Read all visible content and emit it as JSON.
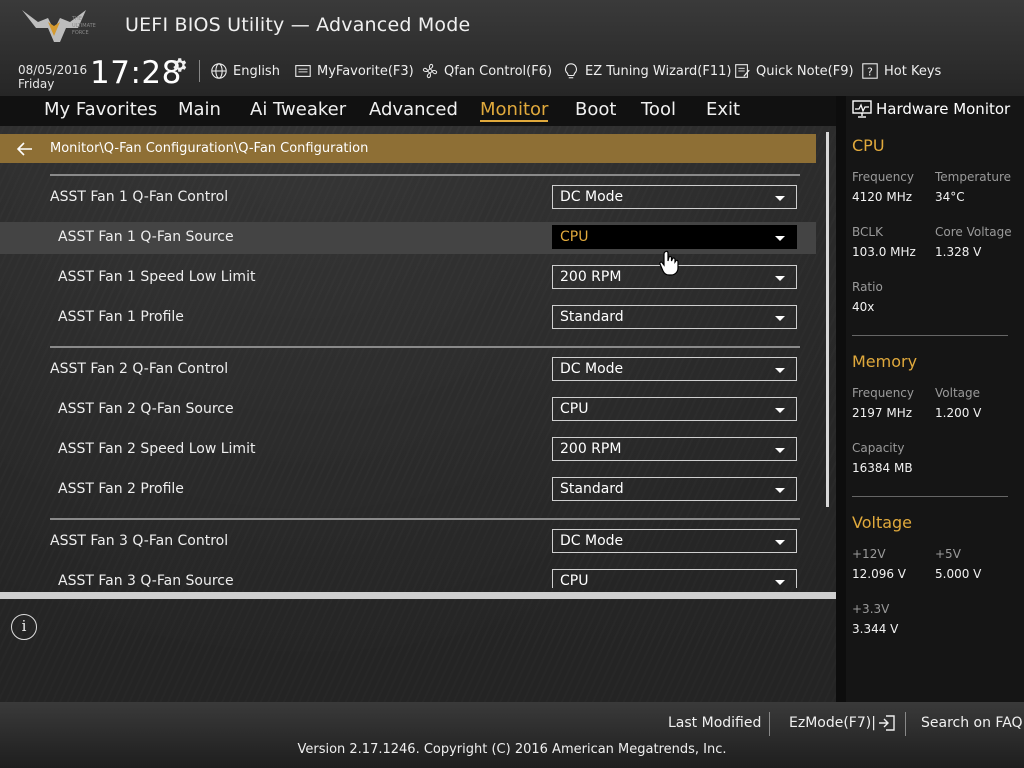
{
  "header": {
    "title": "UEFI BIOS Utility — Advanced Mode",
    "logo_text": [
      "THE",
      "ULTIMATE",
      "FORCE"
    ],
    "date": "08/05/2016",
    "day": "Friday",
    "time": "17:28",
    "toolbar": [
      {
        "label": "English",
        "icon": "globe-icon"
      },
      {
        "label": "MyFavorite(F3)",
        "icon": "favorite-list-icon"
      },
      {
        "label": "Qfan Control(F6)",
        "icon": "fan-icon"
      },
      {
        "label": "EZ Tuning Wizard(F11)",
        "icon": "lightbulb-icon"
      },
      {
        "label": "Quick Note(F9)",
        "icon": "note-icon"
      },
      {
        "label": "Hot Keys",
        "icon": "question-icon"
      }
    ]
  },
  "tabs": [
    "My Favorites",
    "Main",
    "Ai Tweaker",
    "Advanced",
    "Monitor",
    "Boot",
    "Tool",
    "Exit"
  ],
  "active_tab": "Monitor",
  "breadcrumb": "Monitor\\Q-Fan Configuration\\Q-Fan Configuration",
  "settings": [
    {
      "label": "ASST Fan 1 Q-Fan Control",
      "value": "DC Mode"
    },
    {
      "label": "ASST Fan 1 Q-Fan Source",
      "value": "CPU"
    },
    {
      "label": "ASST Fan 1 Speed Low Limit",
      "value": "200 RPM"
    },
    {
      "label": "ASST Fan 1 Profile",
      "value": "Standard"
    },
    {
      "label": "ASST Fan 2 Q-Fan Control",
      "value": "DC Mode"
    },
    {
      "label": "ASST Fan 2 Q-Fan Source",
      "value": "CPU"
    },
    {
      "label": "ASST Fan 2 Speed Low Limit",
      "value": "200 RPM"
    },
    {
      "label": "ASST Fan 2 Profile",
      "value": "Standard"
    },
    {
      "label": "ASST Fan 3 Q-Fan Control",
      "value": "DC Mode"
    },
    {
      "label": "ASST Fan 3 Q-Fan Source",
      "value": "CPU"
    }
  ],
  "hardware_monitor": {
    "title": "Hardware Monitor",
    "cpu": {
      "heading": "CPU",
      "frequency_label": "Frequency",
      "frequency": "4120 MHz",
      "temperature_label": "Temperature",
      "temperature": "34°C",
      "bclk_label": "BCLK",
      "bclk": "103.0 MHz",
      "core_voltage_label": "Core Voltage",
      "core_voltage": "1.328 V",
      "ratio_label": "Ratio",
      "ratio": "40x"
    },
    "memory": {
      "heading": "Memory",
      "frequency_label": "Frequency",
      "frequency": "2197 MHz",
      "voltage_label": "Voltage",
      "voltage": "1.200 V",
      "capacity_label": "Capacity",
      "capacity": "16384 MB"
    },
    "voltage": {
      "heading": "Voltage",
      "v12_label": "+12V",
      "v12": "12.096 V",
      "v5_label": "+5V",
      "v5": "5.000 V",
      "v33_label": "+3.3V",
      "v33": "3.344 V"
    }
  },
  "footer": {
    "last_modified": "Last Modified",
    "ezmode": "EzMode(F7)|",
    "search_faq": "Search on FAQ",
    "copyright": "Version 2.17.1246. Copyright (C) 2016 American Megatrends, Inc."
  },
  "colors": {
    "accent": "#e0a93c",
    "breadcrumb_bg": "#8e6f35"
  }
}
